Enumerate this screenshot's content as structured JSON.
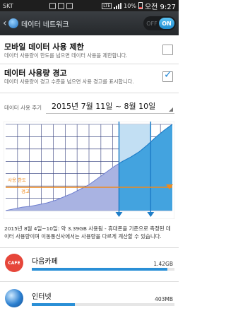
{
  "status_bar": {
    "carrier": "SKT",
    "network": "LTE",
    "battery": "10%",
    "time": "오전 9:27"
  },
  "header": {
    "title": "데이터 네트워크",
    "toggle_off": "OFF",
    "toggle_on": "ON"
  },
  "settings": {
    "limit": {
      "title": "모바일 데이터 사용 제한",
      "desc": "데이터 사용량이 한도를 넘으면 데이터 사용을 제한합니다.",
      "checked": false
    },
    "warning": {
      "title": "데이터 사용량 경고",
      "desc": "데이터 사용량이 경고 수준을 넘으면 사용 경고를 표시합니다.",
      "checked": true
    },
    "cycle": {
      "label": "데이터 사용 주기",
      "value": "2015년 7월 11일 ~ 8월 10일"
    }
  },
  "chart": {
    "warning_label": "경고",
    "limit_label": "사용 한도"
  },
  "summary": "2015년 8월 4일~10일: 약 3.39GB 사용됨 - 휴대폰을 기준으로 측정된 데이터 사용량이며 이동통신사에서는 사용량을 다르게 계산할 수 있습니다.",
  "apps": [
    {
      "icon": "cafe-icon",
      "icon_text": "CAFE",
      "name": "다음카페",
      "size": "1.42GB",
      "fraction": 0.95
    },
    {
      "icon": "ie-icon",
      "name": "인터넷",
      "size": "403MB",
      "fraction": 0.3
    }
  ],
  "chart_data": {
    "type": "area",
    "title": "",
    "xlabel": "",
    "ylabel": "",
    "x": [
      0,
      0.05,
      0.1,
      0.15,
      0.2,
      0.25,
      0.3,
      0.35,
      0.4,
      0.45,
      0.5,
      0.55,
      0.6,
      0.65,
      0.7,
      0.75,
      0.8,
      0.85,
      0.9,
      0.95,
      1.0
    ],
    "values": [
      0.0,
      0.02,
      0.04,
      0.05,
      0.07,
      0.09,
      0.12,
      0.16,
      0.2,
      0.25,
      0.3,
      0.37,
      0.44,
      0.51,
      0.57,
      0.62,
      0.68,
      0.76,
      0.85,
      0.93,
      1.0
    ],
    "warning_level": 0.27,
    "selected_range": [
      0.68,
      0.87
    ],
    "grid": true
  }
}
